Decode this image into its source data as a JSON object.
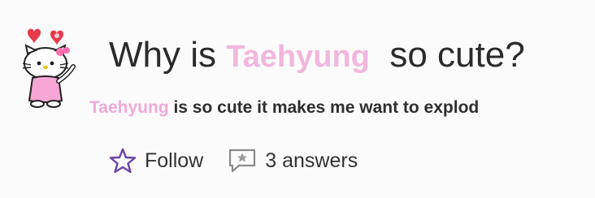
{
  "question": {
    "prefix": "Why is ",
    "name": "Taehyung",
    "suffix": "so cute?"
  },
  "answer": {
    "name": "Taehyung",
    "text": " is so cute it makes me want to explod"
  },
  "actions": {
    "follow_label": "Follow",
    "answers_label": "3 answers"
  },
  "colors": {
    "accent_pink": "#f0b7dd",
    "icon_purple": "#6b45a6",
    "text": "#2b2b2b"
  },
  "icons": [
    "hello-kitty-mascot-icon",
    "star-outline-icon",
    "comment-star-icon"
  ]
}
